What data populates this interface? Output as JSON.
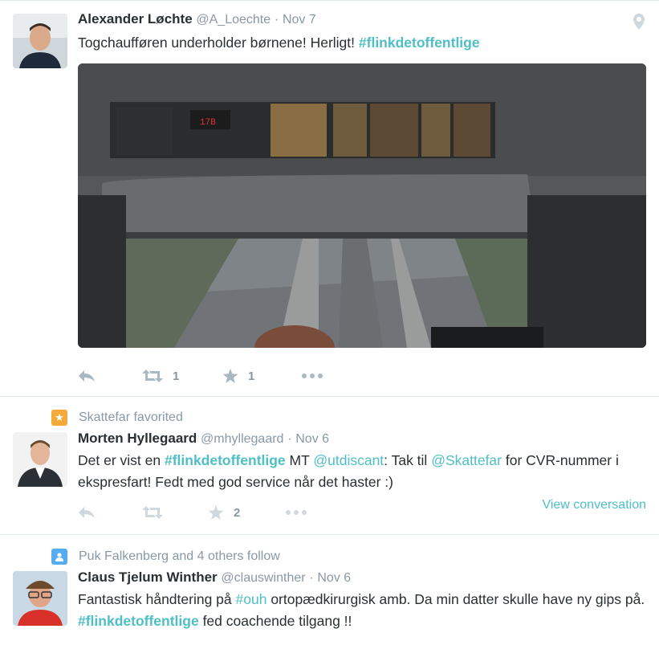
{
  "tweets": [
    {
      "fullname": "Alexander Løchte",
      "handle": "@A_Loechte",
      "separator": "·",
      "time": "Nov 7",
      "text_plain": "Togchaufføren underholder børnene! Herligt! ",
      "text_hashtag": "#flinkdetoffentlige",
      "retweets": "1",
      "favorites": "1"
    },
    {
      "context": "Skattefar favorited",
      "fullname": "Morten Hyllegaard",
      "handle": "@mhyllegaard",
      "separator": "·",
      "time": "Nov 6",
      "text_parts": {
        "p1": "Det er vist en ",
        "h1": "#flinkdetoffentlige",
        "p2": " MT ",
        "m1": "@utdiscant",
        "p3": ": Tak til ",
        "m2": "@Skattefar",
        "p4": " for CVR-nummer i ekspresfart! Fedt med god service når det haster :)"
      },
      "favorites": "2",
      "view_conversation": "View conversation"
    },
    {
      "context": "Puk Falkenberg and 4 others follow",
      "fullname": "Claus Tjelum Winther",
      "handle": "@clauswinther",
      "separator": "·",
      "time": "Nov 6",
      "text_parts": {
        "p1": "Fantastisk håndtering på ",
        "h1": "#ouh",
        "p2": " ortopædkirurgisk amb. Da min datter skulle have ny gips på. ",
        "h2": "#flinkdetoffentlige",
        "p3": " fed coachende tilgang !!"
      }
    }
  ],
  "icons": {
    "reply": "reply-icon",
    "retweet": "retweet-icon",
    "favorite": "star-icon",
    "more": "more-icon",
    "geo": "location-pin-icon",
    "favorited_context": "star-badge-icon",
    "follow_context": "person-badge-icon"
  },
  "colors": {
    "link": "#4fbfc6",
    "meta": "#8899a6",
    "text": "#292f33",
    "favorite_badge": "#f4a93b",
    "follow_badge": "#55acee"
  }
}
